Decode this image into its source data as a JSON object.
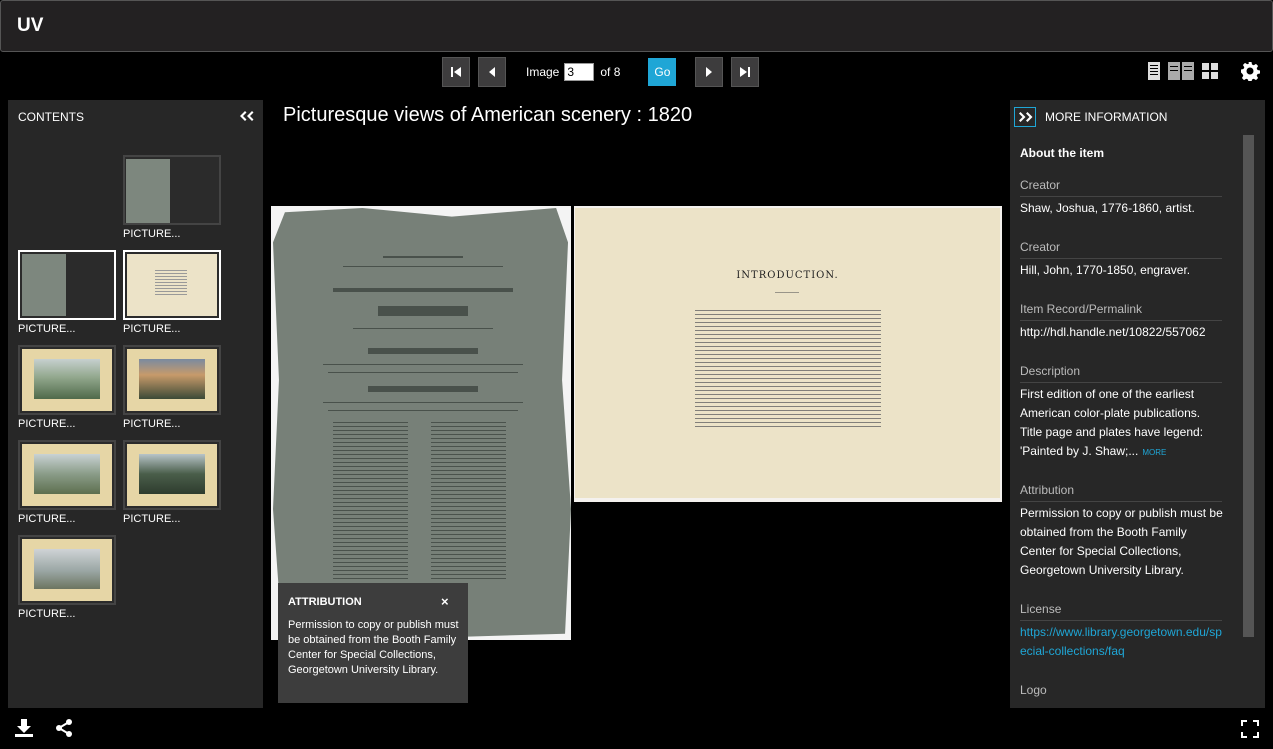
{
  "app": {
    "logo": "UV"
  },
  "pager": {
    "image_label": "Image",
    "current_page": "3",
    "of_label": "of 8",
    "go_label": "Go"
  },
  "contents": {
    "title": "CONTENTS",
    "thumbnails": [
      {
        "label": "PICTURE...",
        "selected": false
      },
      {
        "label": "PICTURE...",
        "selected": true
      },
      {
        "label": "PICTURE...",
        "selected": true
      },
      {
        "label": "PICTURE...",
        "selected": false
      },
      {
        "label": "PICTURE...",
        "selected": false
      },
      {
        "label": "PICTURE...",
        "selected": false
      },
      {
        "label": "PICTURE...",
        "selected": false
      },
      {
        "label": "PICTURE...",
        "selected": false
      }
    ]
  },
  "viewer": {
    "title": "Picturesque views of American scenery : 1820",
    "intro_heading": "INTRODUCTION."
  },
  "attribution": {
    "title": "ATTRIBUTION",
    "close": "×",
    "text": "Permission to copy or publish must be obtained from the Booth Family Center for Special Collections, Georgetown University Library."
  },
  "more_info": {
    "title": "MORE INFORMATION",
    "about": "About the item",
    "creator1_label": "Creator",
    "creator1_value": "Shaw, Joshua, 1776-1860, artist.",
    "creator2_label": "Creator",
    "creator2_value": "Hill, John, 1770-1850, engraver.",
    "permalink_label": "Item Record/Permalink",
    "permalink_value": "http://hdl.handle.net/10822/557062",
    "description_label": "Description",
    "description_value": "First edition of one of the earliest American color-plate publications. Title page and plates have legend: 'Painted by J. Shaw;...",
    "more_link": "MORE",
    "attribution_label": "Attribution",
    "attribution_value": "Permission to copy or publish must be obtained from the Booth Family Center for Special Collections, Georgetown University Library.",
    "license_label": "License",
    "license_value": "https://www.library.georgetown.edu/special-collections/faq",
    "logo_label": "Logo"
  },
  "colors": {
    "accent": "#1fa6d6",
    "panel": "#272727",
    "background": "#000000"
  }
}
